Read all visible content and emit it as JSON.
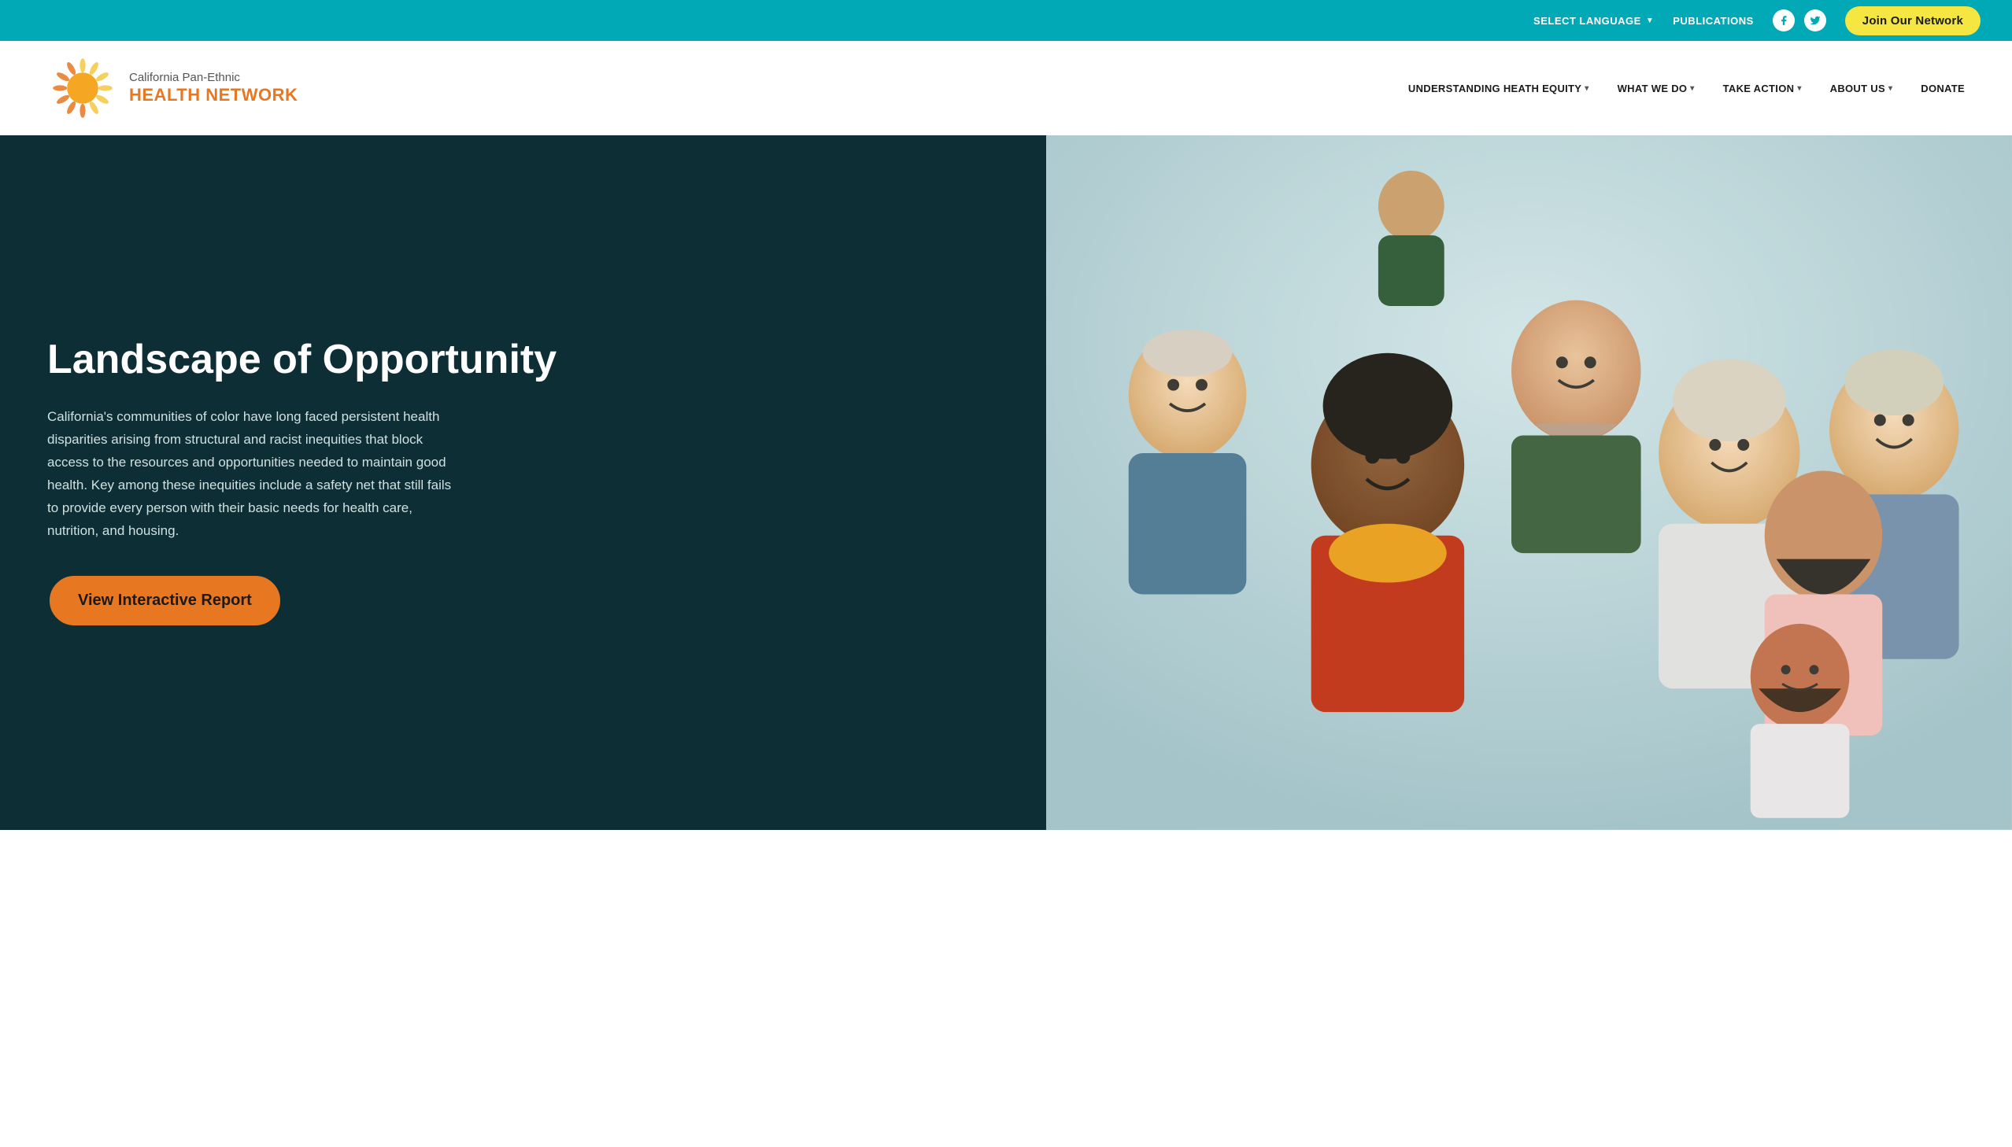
{
  "topbar": {
    "language_label": "SELECT LANGUAGE",
    "publications_label": "PUBLICATIONS",
    "join_btn_label": "Join Our Network",
    "facebook_icon": "f",
    "twitter_icon": "t"
  },
  "header": {
    "logo_text_top": "California Pan-Ethnic",
    "logo_text_bottom": "HEALTH NETWORK",
    "nav": [
      {
        "label": "UNDERSTANDING HEATH EQUITY",
        "has_dropdown": true
      },
      {
        "label": "WHAT WE DO",
        "has_dropdown": true
      },
      {
        "label": "TAKE ACTION",
        "has_dropdown": true
      },
      {
        "label": "ABOUT US",
        "has_dropdown": true
      },
      {
        "label": "DONATE",
        "has_dropdown": false
      }
    ]
  },
  "hero": {
    "title": "Landscape of Opportunity",
    "description": "California's communities of color have long faced persistent health disparities arising from structural and racist inequities that block access to the resources and opportunities needed to maintain good health. Key among these inequities include a safety net that still fails to provide every person with their basic needs for health care, nutrition, and housing.",
    "cta_label": "View Interactive Report"
  }
}
